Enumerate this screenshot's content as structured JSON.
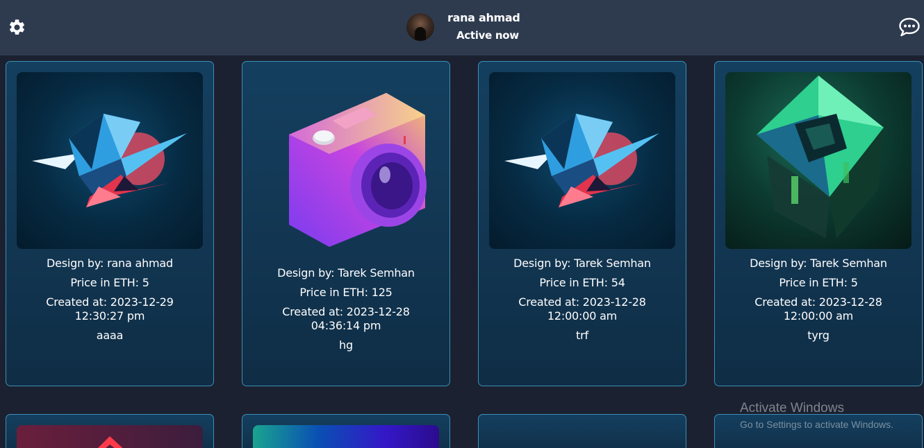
{
  "header": {
    "user_name": "rana ahmad",
    "status": "Active now",
    "settings_icon": "gear-icon",
    "chat_icon": "chat-bubble-icon"
  },
  "cards": [
    {
      "designer": "Design by: rana ahmad",
      "price": "Price in ETH: 5",
      "created": "Created at: 2023-12-29 12:30:27 pm",
      "note": "aaaa",
      "image": "blue-diamond-crystal"
    },
    {
      "designer": "Design by: Tarek Semhan",
      "price": "Price in ETH: 125",
      "created": "Created at: 2023-12-28 04:36:14 pm",
      "note": "hg",
      "image": "camera-3d-icon"
    },
    {
      "designer": "Design by: Tarek Semhan",
      "price": "Price in ETH: 54",
      "created": "Created at: 2023-12-28 12:00:00 am",
      "note": "trf",
      "image": "blue-diamond-crystal"
    },
    {
      "designer": "Design by: Tarek Semhan",
      "price": "Price in ETH: 5",
      "created": "Created at: 2023-12-28 12:00:00 am",
      "note": "tyrg",
      "image": "green-cube-abstract"
    }
  ],
  "watermark": {
    "title": "Activate Windows",
    "subtitle": "Go to Settings to activate Windows."
  },
  "colors": {
    "topbar": "#2e3b4f",
    "background": "#1b2130",
    "card": "#143f5f",
    "card_border": "#3c8fb7"
  }
}
